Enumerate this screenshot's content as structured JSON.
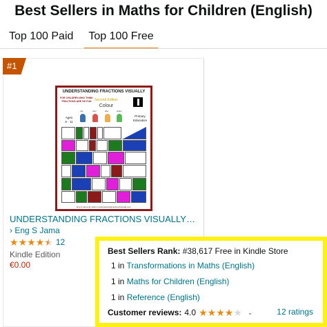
{
  "header": {
    "title": "Best Sellers in Maths for Children (English)"
  },
  "tabs": [
    {
      "label": "Top 100 Paid",
      "active": false
    },
    {
      "label": "Top 100 Free",
      "active": true
    }
  ],
  "product": {
    "rank_badge": "#1",
    "cover": {
      "title": "UNDERSTANDING FRACTIONS VISUALLY",
      "left_text": "FOR CHILDREN WHO THINK FRACTIONS ARE NO FUN",
      "edition": "Second Edition",
      "colour": "Colour",
      "ages_label": "Ages",
      "ages_value": "6 - 11",
      "primary_label": "Primary",
      "education_label": "Education",
      "kids": [
        "Jan",
        "Alex",
        "Ella",
        "Hallie"
      ],
      "footer": "Eng S Jama @ author.UnderstandingFractionsVisually.com"
    },
    "title": "UNDERSTANDING FRACTIONS VISUALLY…",
    "author": "› Eng S Jama",
    "rating_stars": 4.5,
    "rating_count": "12",
    "format": "Kindle Edition",
    "price": "€0.00"
  },
  "details": {
    "bsr_label": "Best Sellers Rank:",
    "bsr_value": "#38,617 Free in Kindle Store",
    "ranks": [
      {
        "prefix": "1 in",
        "category": "Transformations in Maths (English)"
      },
      {
        "prefix": "1 in",
        "category": "Maths for Children (English)"
      },
      {
        "prefix": "1 in",
        "category": "Reference (English)"
      }
    ],
    "reviews_label": "Customer reviews:",
    "reviews_value": "4.0",
    "reviews_stars": 4,
    "ratings_link": "12 ratings"
  },
  "colors": {
    "accent_orange": "#c45500",
    "link": "#007185",
    "price": "#b12704",
    "star": "#e38a17",
    "highlight": "#fff212"
  }
}
